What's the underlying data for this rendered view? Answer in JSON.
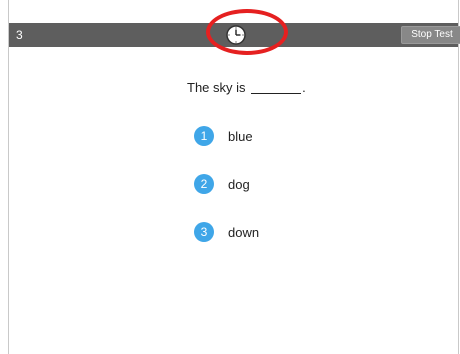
{
  "header": {
    "question_number": "3",
    "timer_icon": "clock-icon",
    "stop_test_label": "Stop Test"
  },
  "question": {
    "text_before_blank": "The sky is",
    "text_after_blank": "."
  },
  "answers": [
    {
      "number": "1",
      "label": "blue"
    },
    {
      "number": "2",
      "label": "dog"
    },
    {
      "number": "3",
      "label": "down"
    }
  ],
  "colors": {
    "topbar": "#5e5e5e",
    "answer_badge": "#3fa6e8",
    "highlight": "#e52020"
  }
}
